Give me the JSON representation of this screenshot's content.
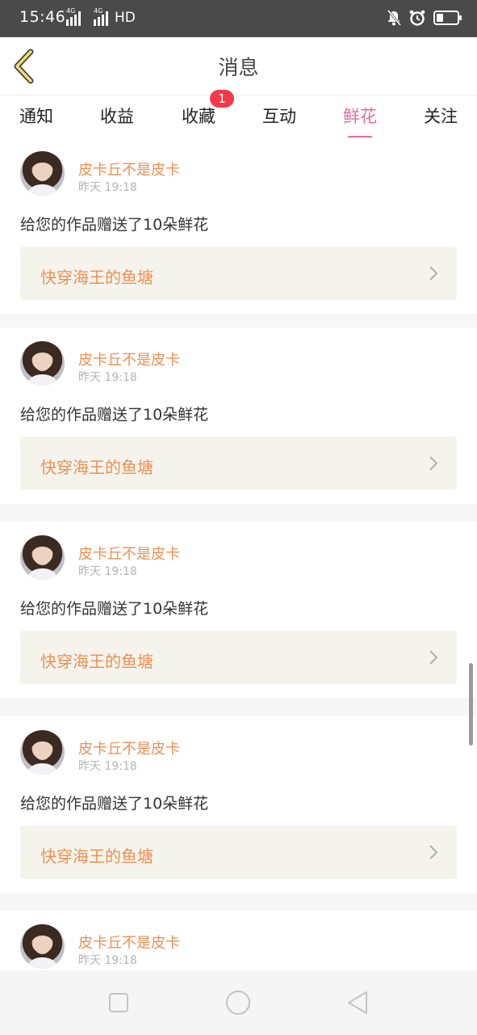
{
  "status_bar": {
    "time": "15:46",
    "net1": "4G",
    "net2": "4G",
    "hd": "HD",
    "battery_level": 0.35
  },
  "header": {
    "title": "消息",
    "back_icon": "chevron-left-icon"
  },
  "tabs": [
    {
      "label": "通知",
      "active": false
    },
    {
      "label": "收益",
      "active": false
    },
    {
      "label": "收藏",
      "active": false,
      "badge": "1"
    },
    {
      "label": "互动",
      "active": false
    },
    {
      "label": "鲜花",
      "active": true
    },
    {
      "label": "关注",
      "active": false
    }
  ],
  "colors": {
    "accent": "#e96a9f",
    "name_orange": "#ef8f52",
    "badge_red": "#f33a4a",
    "card_link_bg": "#f4f4ec"
  },
  "feed": [
    {
      "username": "皮卡丘不是皮卡",
      "time": "昨天 19:18",
      "message": "给您的作品赠送了10朵鲜花",
      "work_title": "快穿海王的鱼塘"
    },
    {
      "username": "皮卡丘不是皮卡",
      "time": "昨天 19:18",
      "message": "给您的作品赠送了10朵鲜花",
      "work_title": "快穿海王的鱼塘"
    },
    {
      "username": "皮卡丘不是皮卡",
      "time": "昨天 19:18",
      "message": "给您的作品赠送了10朵鲜花",
      "work_title": "快穿海王的鱼塘"
    },
    {
      "username": "皮卡丘不是皮卡",
      "time": "昨天 19:18",
      "message": "给您的作品赠送了10朵鲜花",
      "work_title": "快穿海王的鱼塘"
    },
    {
      "username": "皮卡丘不是皮卡",
      "time": "昨天 19:18",
      "message": "",
      "work_title": ""
    }
  ],
  "nav_bar": {
    "recent_icon": "square-icon",
    "home_icon": "circle-icon",
    "back_icon": "triangle-back-icon"
  }
}
